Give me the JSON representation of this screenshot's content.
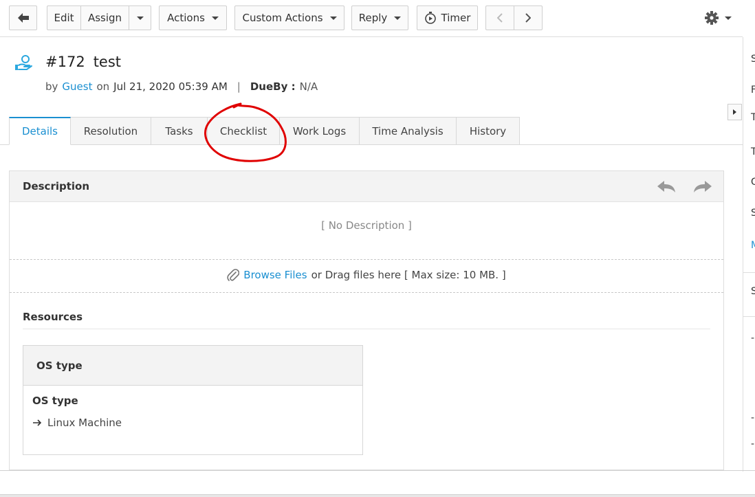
{
  "toolbar": {
    "edit_label": "Edit",
    "assign_label": "Assign",
    "actions_label": "Actions",
    "custom_actions_label": "Custom Actions",
    "reply_label": "Reply",
    "timer_label": "Timer"
  },
  "request": {
    "number": "#172",
    "subject": "test",
    "by_label": "by",
    "requester": "Guest",
    "on_label": "on",
    "created": "Jul 21, 2020 05:39 AM",
    "separator": "|",
    "dueby_label": "DueBy :",
    "dueby_value": "N/A"
  },
  "tabs": [
    {
      "label": "Details"
    },
    {
      "label": "Resolution"
    },
    {
      "label": "Tasks"
    },
    {
      "label": "Checklist"
    },
    {
      "label": "Work Logs"
    },
    {
      "label": "Time Analysis"
    },
    {
      "label": "History"
    }
  ],
  "description": {
    "title": "Description",
    "empty_text": "[ No Description ]"
  },
  "attachments": {
    "browse_label": "Browse Files",
    "hint": "or Drag files here [ Max size: 10 MB. ]"
  },
  "resources": {
    "title": "Resources",
    "box_title": "OS type",
    "field_label": "OS type",
    "field_value": "Linux Machine"
  },
  "right_panel": {
    "letters": [
      "S",
      "F",
      "T",
      "T",
      "G",
      "S",
      "M",
      "S",
      "-",
      "-",
      "-"
    ]
  },
  "colors": {
    "accent": "#1a8fd1",
    "annotation": "#e00000"
  }
}
